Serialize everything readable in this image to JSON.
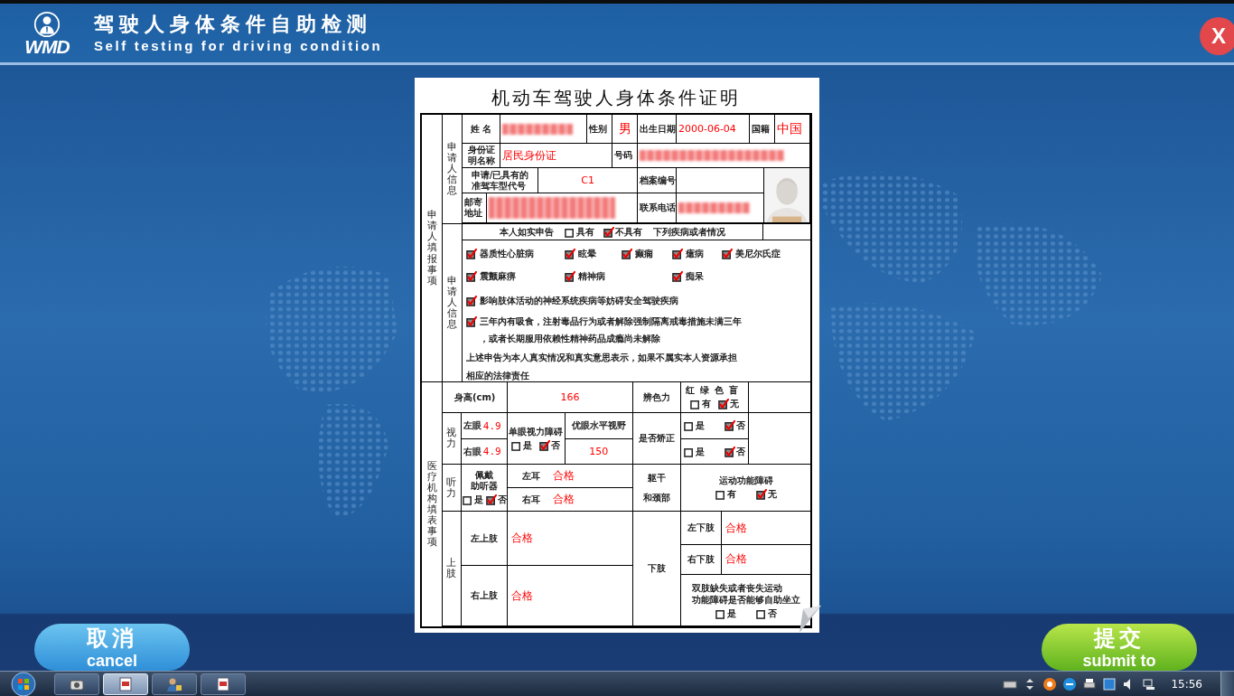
{
  "header": {
    "logo_text": "WMD",
    "title": "驾驶人身体条件自助检测",
    "subtitle": "Self testing for driving condition",
    "close_label": "X"
  },
  "form": {
    "title": "机动车驾驶人身体条件证明",
    "applicant_section": {
      "label": "申请人填报事项",
      "info": {
        "label": "申请人信息",
        "name": {
          "label": "姓 名",
          "blurred": true
        },
        "sex": {
          "label": "性别",
          "value": "男"
        },
        "birth_date": {
          "label": "出生日期",
          "value": "2000-06-04"
        },
        "nationality": {
          "label": "国籍",
          "value": "中国"
        },
        "id_type": {
          "label": [
            "身份证",
            "明名称"
          ],
          "value": "居民身份证"
        },
        "id_number": {
          "label": "号码",
          "blurred": true
        },
        "vehicle_class": {
          "label": [
            "申请/已具有的",
            "准驾车型代号"
          ],
          "value": "C1"
        },
        "file_number": {
          "label": "档案编号"
        },
        "address": {
          "label": [
            "邮寄",
            "地址"
          ],
          "blurred": true
        },
        "phone": {
          "label": "联系电话",
          "blurred": true
        }
      },
      "declaration": {
        "label": "申请人信息",
        "statement": {
          "prefix": "本人如实申告",
          "options": [
            {
              "label": "具有",
              "checked": false
            },
            {
              "label": "不具有",
              "checked": true
            }
          ],
          "suffix": "下列疾病或者情况"
        },
        "conditions": [
          {
            "label": "器质性心脏病",
            "checked": true
          },
          {
            "label": "眩晕",
            "checked": true
          },
          {
            "label": "癫痫",
            "checked": true
          },
          {
            "label": "癔病",
            "checked": true
          },
          {
            "label": "美尼尔氏症",
            "checked": true
          },
          {
            "label": "震颤麻痹",
            "checked": true
          },
          {
            "label": "精神病",
            "checked": true
          },
          {
            "label": "痴呆",
            "checked": true
          },
          {
            "label": "影响肢体活动的神经系统疾病等妨碍安全驾驶疾病",
            "checked": true
          },
          {
            "label": [
              "三年内有吸食，注射毒品行为或者解除强制隔离戒毒措施未满三年",
              "，或者长期服用依赖性精神药品成瘾尚未解除"
            ],
            "checked": true
          }
        ],
        "note": [
          "上述申告为本人真实情况和真实意思表示，如果不属实本人资源承担",
          "相应的法律责任"
        ]
      }
    },
    "medical_section": {
      "label": "医疗机构填表事项",
      "height": {
        "label": "身高(cm)",
        "value": "166"
      },
      "color_vision": {
        "label": "辨色力",
        "question": "红绿色盲",
        "options": [
          {
            "label": "有",
            "checked": false
          },
          {
            "label": "无",
            "checked": true
          }
        ]
      },
      "vision": {
        "label": "视力",
        "left_eye": {
          "label": "左眼",
          "value": "4.9"
        },
        "right_eye": {
          "label": "右眼",
          "value": "4.9"
        },
        "monocular": {
          "label": "单眼视力障碍",
          "options": [
            {
              "label": "是",
              "checked": false
            },
            {
              "label": "否",
              "checked": true
            }
          ]
        },
        "field": {
          "label": "优眼水平视野",
          "value": "150"
        },
        "correction": {
          "label": "是否矫正",
          "rows": [
            [
              {
                "label": "是",
                "checked": false
              },
              {
                "label": "否",
                "checked": true
              }
            ],
            [
              {
                "label": "是",
                "checked": false
              },
              {
                "label": "否",
                "checked": true
              }
            ]
          ]
        }
      },
      "hearing": {
        "label": "听力",
        "aid": {
          "label": [
            "佩戴",
            "助听器"
          ],
          "options": [
            {
              "label": "是",
              "checked": false
            },
            {
              "label": "否",
              "checked": true
            }
          ]
        },
        "left_ear": {
          "label": "左耳",
          "value": "合格"
        },
        "right_ear": {
          "label": "右耳",
          "value": "合格"
        }
      },
      "trunk": {
        "label": [
          "躯干",
          "和颈部"
        ]
      },
      "motor": {
        "label": "运动功能障碍",
        "options": [
          {
            "label": "有",
            "checked": false
          },
          {
            "label": "无",
            "checked": true
          }
        ]
      },
      "upper_limbs": {
        "label": "上肢",
        "left": {
          "label": "左上肢",
          "value": "合格"
        },
        "right": {
          "label": "右上肢",
          "value": "合格"
        }
      },
      "lower_limbs": {
        "label": "下肢",
        "left": {
          "label": "左下肢",
          "value": "合格"
        },
        "right": {
          "label": "右下肢",
          "value": "合格"
        },
        "sitting": {
          "label": [
            "双肢缺失或者丧失运动",
            "功能障碍是否能够自助坐立"
          ],
          "options": [
            {
              "label": "是",
              "checked": false
            },
            {
              "label": "否",
              "checked": false
            }
          ]
        }
      }
    }
  },
  "buttons": [
    {
      "kind": "cancel",
      "label": "取消",
      "sublabel": "cancel"
    },
    {
      "kind": "submit",
      "label": "提交",
      "sublabel": "submit to"
    }
  ],
  "taskbar": {
    "apps": [
      {
        "kind": "camera",
        "selected": false
      },
      {
        "kind": "document",
        "selected": true
      },
      {
        "kind": "user",
        "selected": false
      },
      {
        "kind": "document",
        "selected": false
      }
    ],
    "clock": "15:56"
  }
}
